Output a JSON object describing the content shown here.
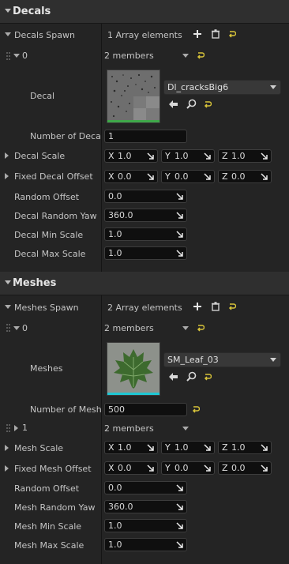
{
  "decals": {
    "section_title": "Decals",
    "spawn_label": "Decals Spawn",
    "spawn_count": "1 Array elements",
    "element0_index": "0",
    "element0_members": "2 members",
    "decal_label": "Decal",
    "decal_asset": "Dl_cracksBig6",
    "number_label": "Number of Decals",
    "number_value": "1",
    "scale_label": "Decal Scale",
    "scale": {
      "x": "1.0",
      "y": "1.0",
      "z": "1.0"
    },
    "offset_label": "Fixed Decal Offset",
    "offset": {
      "x": "0.0",
      "y": "0.0",
      "z": "0.0"
    },
    "random_offset_label": "Random Offset",
    "random_offset_value": "0.0",
    "random_yaw_label": "Decal Random Yaw",
    "random_yaw_value": "360.0",
    "min_scale_label": "Decal Min Scale",
    "min_scale_value": "1.0",
    "max_scale_label": "Decal Max Scale",
    "max_scale_value": "1.0"
  },
  "meshes": {
    "section_title": "Meshes",
    "spawn_label": "Meshes Spawn",
    "spawn_count": "2 Array elements",
    "element0_index": "0",
    "element0_members": "2 members",
    "mesh_label": "Meshes",
    "mesh_asset": "SM_Leaf_03",
    "number_label": "Number of Meshe",
    "number_value": "500",
    "element1_index": "1",
    "element1_members": "2 members",
    "scale_label": "Mesh Scale",
    "scale": {
      "x": "1.0",
      "y": "1.0",
      "z": "1.0"
    },
    "offset_label": "Fixed Mesh Offset",
    "offset": {
      "x": "0.0",
      "y": "0.0",
      "z": "0.0"
    },
    "random_offset_label": "Random Offset",
    "random_offset_value": "0.0",
    "random_yaw_label": "Mesh Random Yaw",
    "random_yaw_value": "360.0",
    "min_scale_label": "Mesh Min Scale",
    "min_scale_value": "1.0",
    "max_scale_label": "Mesh Max Scale",
    "max_scale_value": "1.0"
  },
  "axis_labels": {
    "x": "X",
    "y": "Y",
    "z": "Z"
  },
  "colors": {
    "reset_arrow": "#d8c43a",
    "asset_bar_decal": "#3fa84a",
    "asset_bar_mesh": "#1fc7d4"
  }
}
